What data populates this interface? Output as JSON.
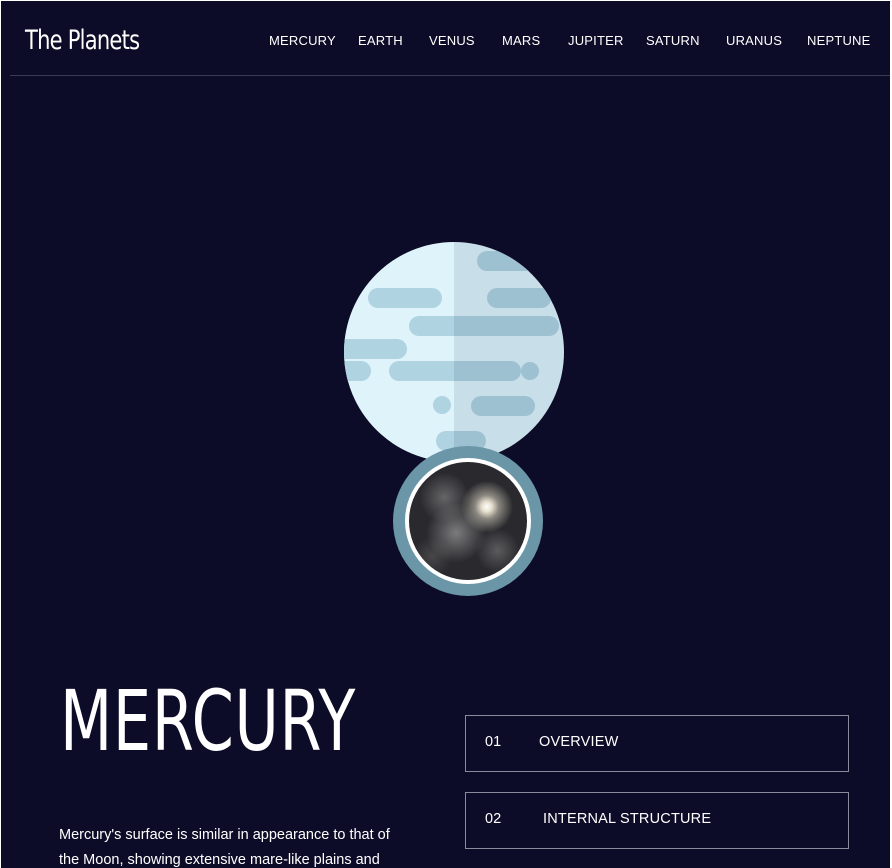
{
  "header": {
    "logo": "The Planets",
    "nav": [
      "MERCURY",
      "EARTH",
      "VENUS",
      "MARS",
      "JUPITER",
      "SATURN",
      "URANUS",
      "NEPTUNE"
    ]
  },
  "planet": {
    "name": "MERCURY",
    "description": "Mercury's surface is similar in appearance to that of the Moon, showing extensive mare-like plains and",
    "icons": {
      "planet": "mercury-planet-icon",
      "geology": "surface-geology-image"
    },
    "colors": {
      "background": "#0d0c28",
      "planet_light": "#dff3fb",
      "planet_shade": "#cde2ea",
      "planet_bands": "#b0d3e2",
      "pin": "#6a96a8"
    }
  },
  "tabs": [
    {
      "num": "01",
      "label": "OVERVIEW"
    },
    {
      "num": "02",
      "label": "INTERNAL STRUCTURE"
    }
  ]
}
